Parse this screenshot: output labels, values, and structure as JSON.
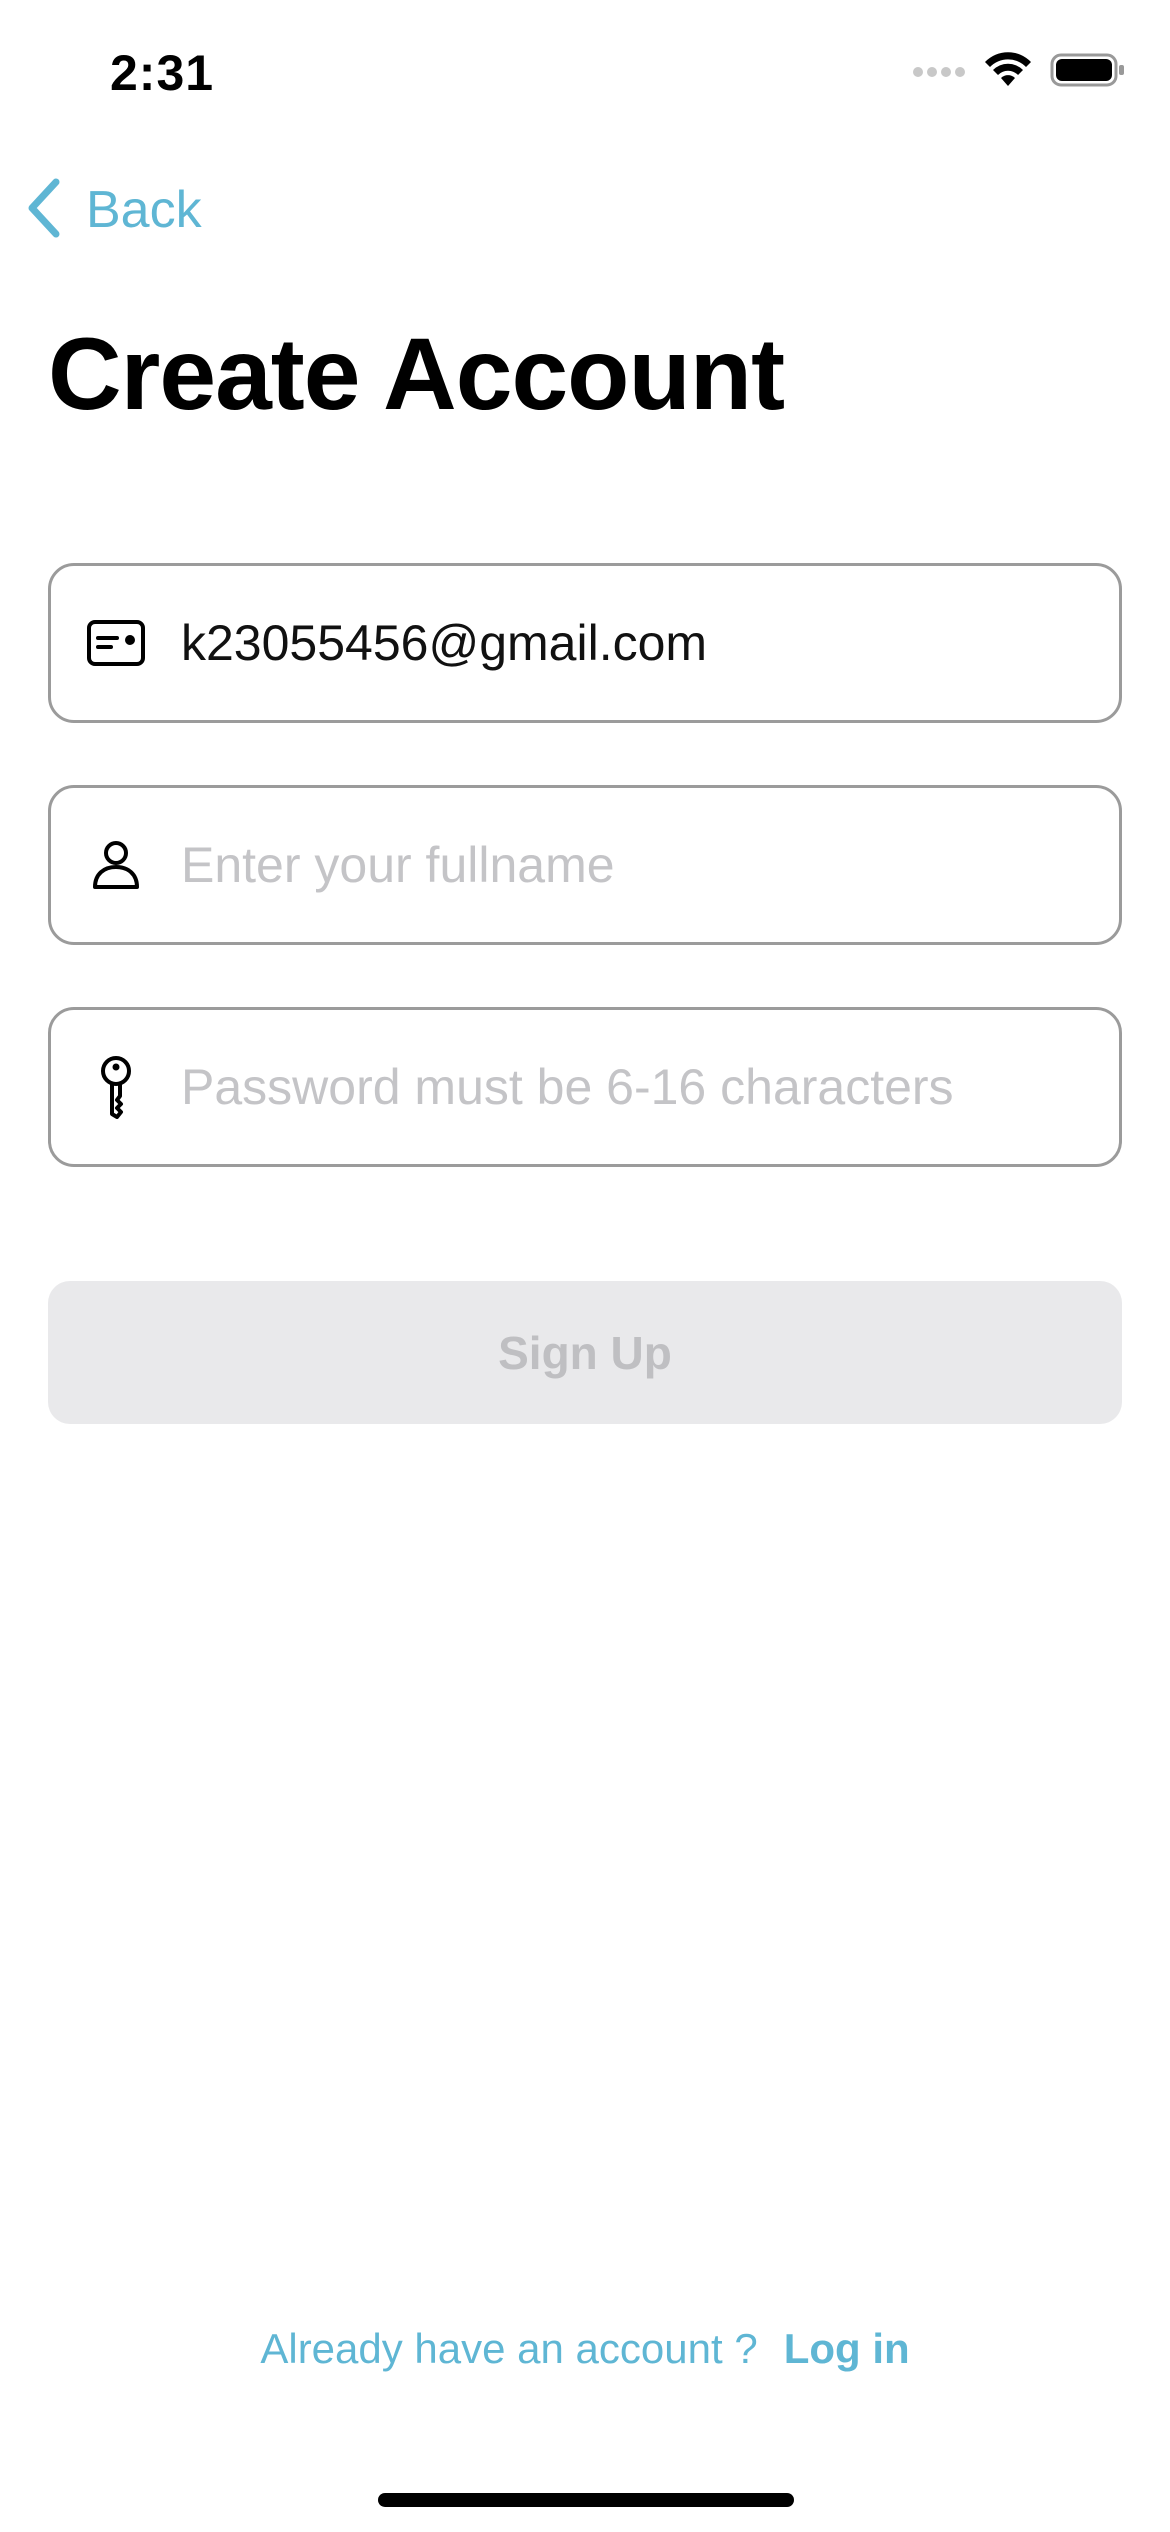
{
  "status_bar": {
    "time": "2:31"
  },
  "nav": {
    "back_label": "Back"
  },
  "page": {
    "title": "Create Account"
  },
  "form": {
    "email": {
      "value": "k23055456@gmail.com",
      "icon": "id-card-icon"
    },
    "fullname": {
      "value": "",
      "placeholder": "Enter your fullname",
      "icon": "person-icon"
    },
    "password": {
      "value": "",
      "placeholder": "Password must be 6-16 characters",
      "icon": "key-icon"
    },
    "submit_label": "Sign Up"
  },
  "footer": {
    "prompt": "Already have an account ?",
    "login_label": "Log in"
  },
  "colors": {
    "accent": "#5fb6d4",
    "field_border": "#9b9b9b",
    "placeholder": "#c4c4c7",
    "disabled_button_bg": "#e9e9eb",
    "disabled_button_text": "#bfbfc2"
  }
}
